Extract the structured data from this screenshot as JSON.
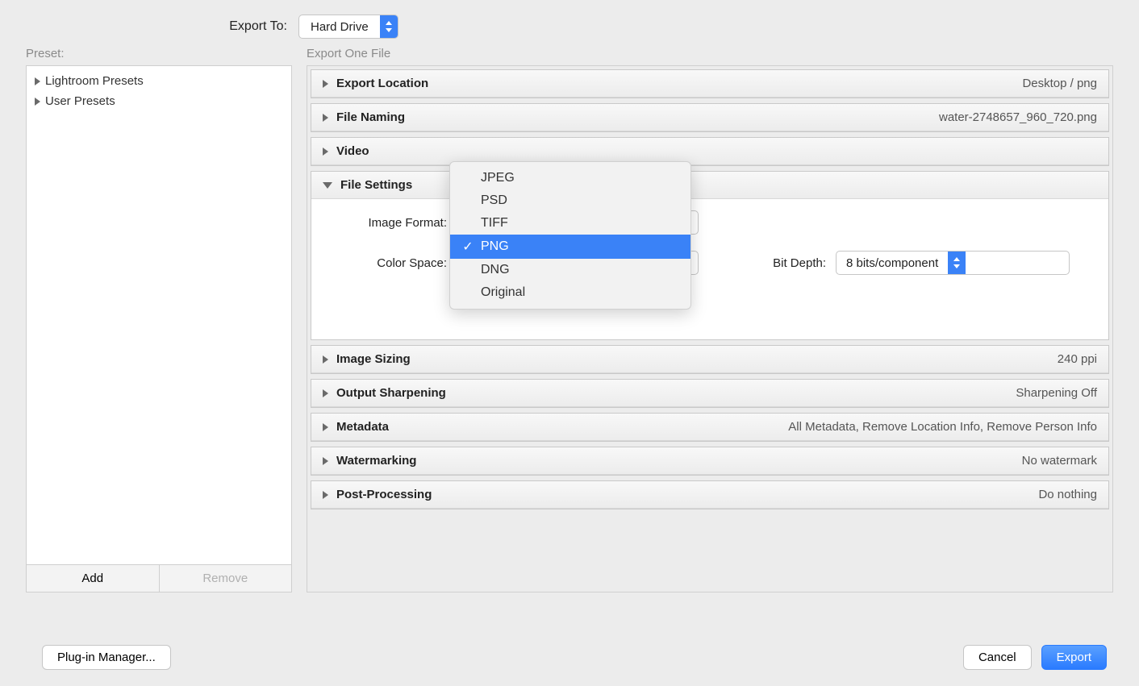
{
  "top": {
    "export_to_label": "Export To:",
    "export_to_value": "Hard Drive"
  },
  "sidebar": {
    "preset_label": "Preset:",
    "items": [
      {
        "label": "Lightroom Presets"
      },
      {
        "label": "User Presets"
      }
    ],
    "add_label": "Add",
    "remove_label": "Remove"
  },
  "main": {
    "header_label": "Export One File",
    "panels": {
      "export_location": {
        "title": "Export Location",
        "summary": "Desktop / png"
      },
      "file_naming": {
        "title": "File Naming",
        "summary": "water-2748657_960_720.png"
      },
      "video": {
        "title": "Video",
        "summary": ""
      },
      "file_settings": {
        "title": "File Settings",
        "image_format_label": "Image Format:",
        "color_space_label": "Color Space:",
        "bit_depth_label": "Bit Depth:",
        "bit_depth_value": "8 bits/component",
        "format_options": [
          "JPEG",
          "PSD",
          "TIFF",
          "PNG",
          "DNG",
          "Original"
        ],
        "format_selected": "PNG"
      },
      "image_sizing": {
        "title": "Image Sizing",
        "summary": "240 ppi"
      },
      "output_sharpening": {
        "title": "Output Sharpening",
        "summary": "Sharpening Off"
      },
      "metadata": {
        "title": "Metadata",
        "summary": "All Metadata, Remove Location Info, Remove Person Info"
      },
      "watermarking": {
        "title": "Watermarking",
        "summary": "No watermark"
      },
      "post_processing": {
        "title": "Post-Processing",
        "summary": "Do nothing"
      }
    }
  },
  "footer": {
    "plugin_manager_label": "Plug-in Manager...",
    "cancel_label": "Cancel",
    "export_label": "Export"
  }
}
